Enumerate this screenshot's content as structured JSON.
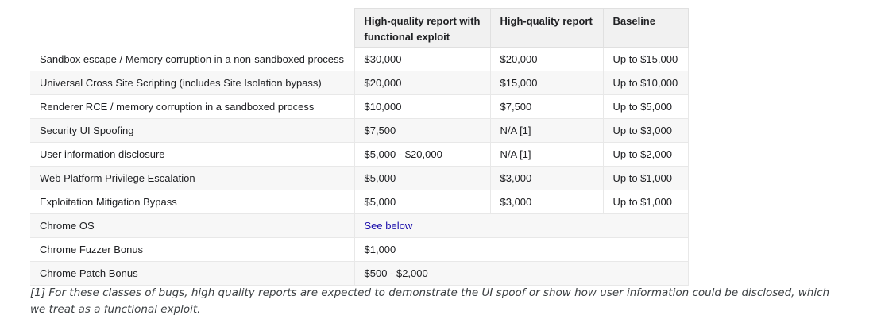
{
  "table": {
    "headers": {
      "exploit": "High-quality report with functional exploit",
      "high_quality": "High-quality report",
      "baseline": "Baseline"
    },
    "rows": [
      {
        "label": "Sandbox escape / Memory corruption in a non-sandboxed process",
        "exploit": "$30,000",
        "high_quality": "$20,000",
        "baseline": "Up to $15,000"
      },
      {
        "label": "Universal Cross Site Scripting (includes Site Isolation bypass)",
        "exploit": "$20,000",
        "high_quality": "$15,000",
        "baseline": "Up to $10,000"
      },
      {
        "label": "Renderer RCE / memory corruption in a sandboxed process",
        "exploit": "$10,000",
        "high_quality": "$7,500",
        "baseline": "Up to $5,000"
      },
      {
        "label": "Security UI Spoofing",
        "exploit": "$7,500",
        "high_quality": "N/A [1]",
        "baseline": "Up to $3,000"
      },
      {
        "label": "User information disclosure",
        "exploit": "$5,000 - $20,000",
        "high_quality": "N/A [1]",
        "baseline": "Up to $2,000"
      },
      {
        "label": "Web Platform Privilege Escalation",
        "exploit": "$5,000",
        "high_quality": "$3,000",
        "baseline": "Up to $1,000"
      },
      {
        "label": "Exploitation Mitigation Bypass",
        "exploit": "$5,000",
        "high_quality": "$3,000",
        "baseline": "Up to $1,000"
      },
      {
        "label": "Chrome OS",
        "exploit": "See below"
      },
      {
        "label": "Chrome Fuzzer Bonus",
        "exploit": "$1,000"
      },
      {
        "label": "Chrome Patch Bonus",
        "exploit": "$500 - $2,000"
      }
    ]
  },
  "footnote": "[1] For these classes of bugs, high quality reports are expected to demonstrate the UI spoof or show how user information could be disclosed, which we treat as a functional exploit.",
  "colors": {
    "link": "#1a0dab",
    "header_bg": "#f1f1f1",
    "stripe_bg": "#f7f7f7"
  }
}
